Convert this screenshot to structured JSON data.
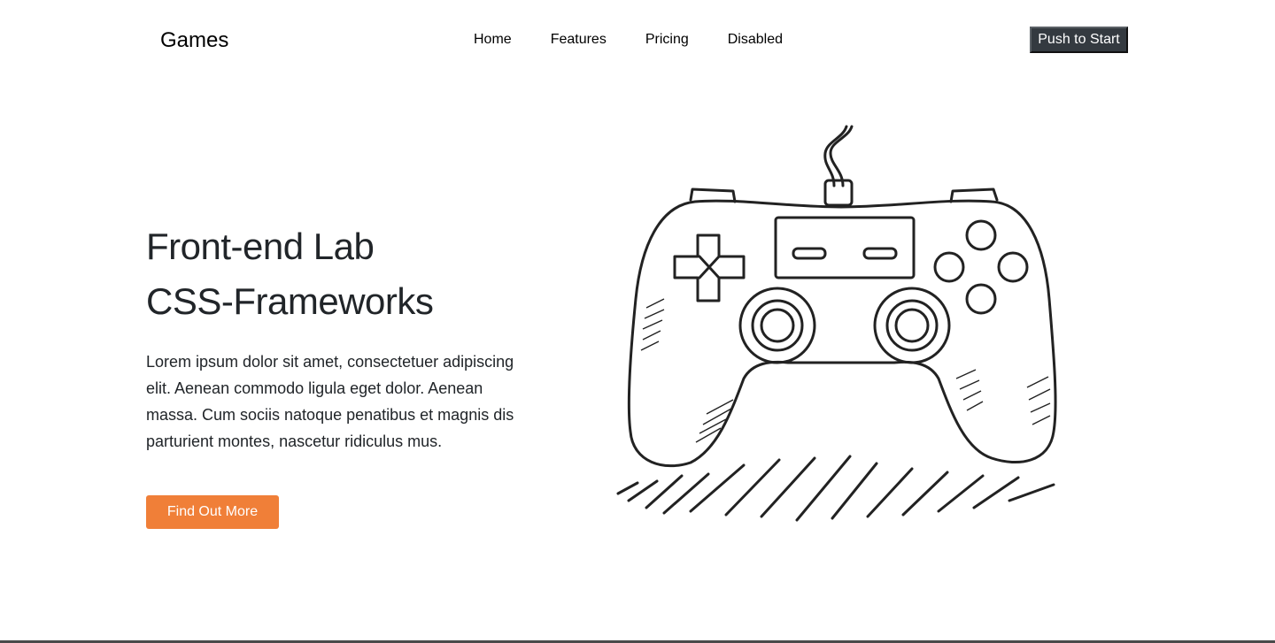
{
  "nav": {
    "brand": "Games",
    "links": [
      {
        "label": "Home"
      },
      {
        "label": "Features"
      },
      {
        "label": "Pricing"
      },
      {
        "label": "Disabled"
      }
    ],
    "cta_label": "Push to Start"
  },
  "hero": {
    "title_line1": "Front-end Lab",
    "title_line2": "CSS-Frameworks",
    "paragraph": "Lorem ipsum dolor sit amet, consectetuer adipiscing elit. Aenean commodo ligula eget dolor. Aenean massa. Cum sociis natoque penatibus et magnis dis parturient montes, nascetur ridiculus mus.",
    "button_label": "Find Out More",
    "illustration_icon": "gamepad-controller-sketch"
  },
  "colors": {
    "accent": "#f07f38",
    "dark_button": "#343a40",
    "text": "#212529"
  }
}
